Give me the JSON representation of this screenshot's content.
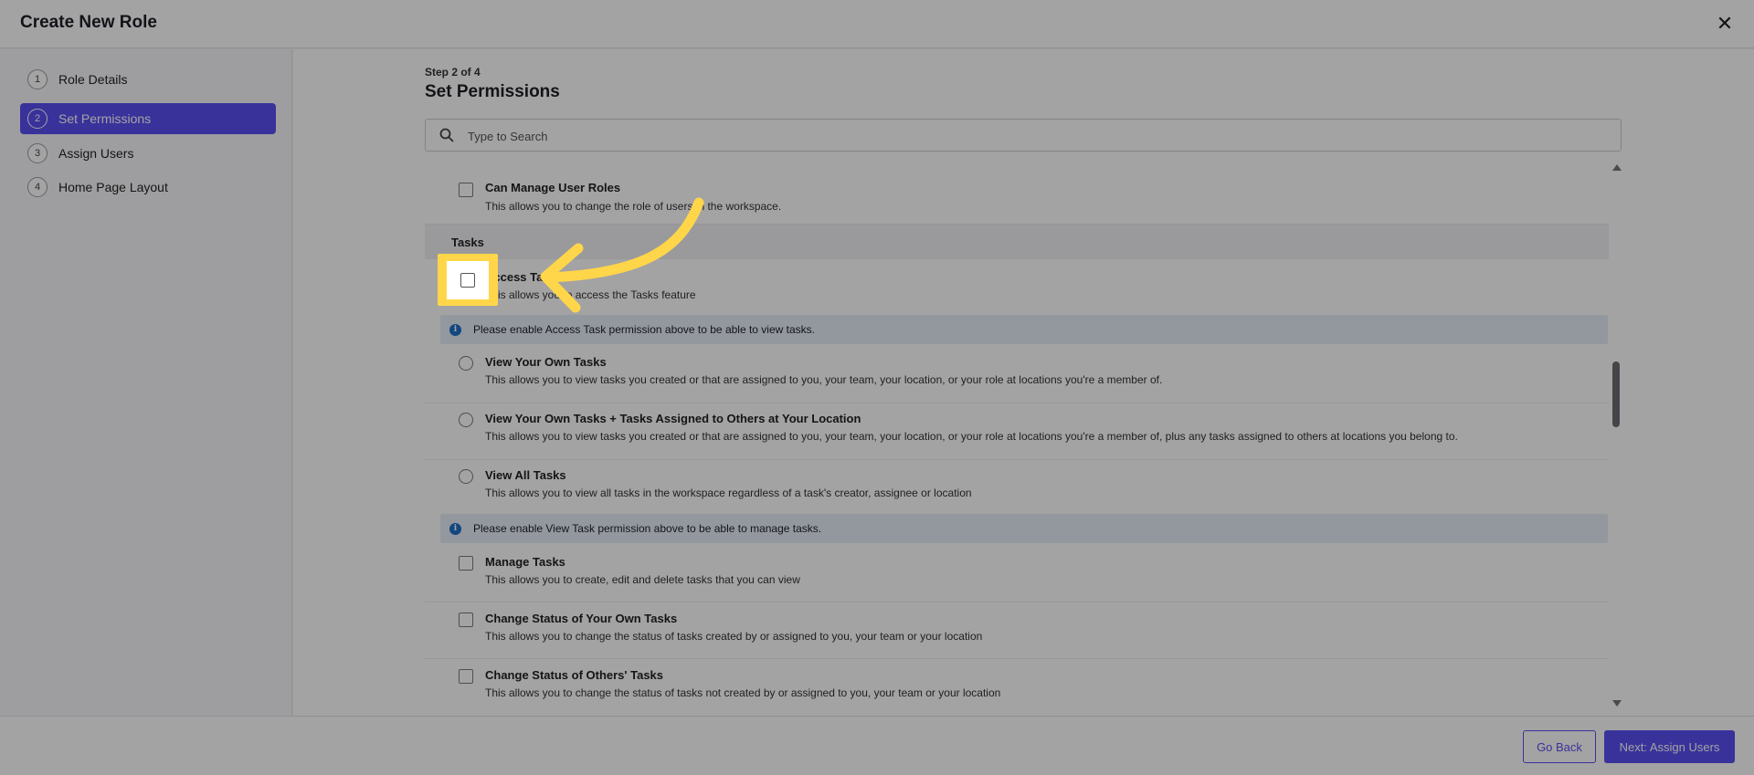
{
  "window": {
    "title": "Create New Role",
    "close_icon": "close-icon"
  },
  "sidebar": {
    "steps": [
      {
        "num": "1",
        "label": "Role Details"
      },
      {
        "num": "2",
        "label": "Set Permissions"
      },
      {
        "num": "3",
        "label": "Assign Users"
      },
      {
        "num": "4",
        "label": "Home Page Layout"
      }
    ],
    "active_step": 2
  },
  "main": {
    "step_label": "Step 2 of 4",
    "title": "Set Permissions",
    "search": {
      "placeholder": "Type to Search",
      "value": ""
    }
  },
  "permissions": {
    "manage_user_roles": {
      "name": "Can Manage User Roles",
      "desc": "This allows you to change the role of users in the workspace."
    },
    "tasks_section": "Tasks",
    "access_tasks": {
      "name": "Access Tasks",
      "desc": "This allows you to access the Tasks feature"
    },
    "info_access": "Please enable Access Task permission above to be able to view tasks.",
    "view_own": {
      "name": "View Your Own Tasks",
      "desc": "This allows you to view tasks you created or that are assigned to you, your team, your location, or your role at locations you're a member of."
    },
    "view_own_location": {
      "name": "View Your Own Tasks + Tasks Assigned to Others at Your Location",
      "desc": "This allows you to view tasks you created or that are assigned to you, your team, your location, or your role at locations you're a member of, plus any tasks assigned to others at locations you belong to."
    },
    "view_all": {
      "name": "View All Tasks",
      "desc": "This allows you to view all tasks in the workspace regardless of a task's creator, assignee or location"
    },
    "info_view": "Please enable View Task permission above to be able to manage tasks.",
    "manage": {
      "name": "Manage Tasks",
      "desc": "This allows you to create, edit and delete tasks that you can view"
    },
    "status_own": {
      "name": "Change Status of Your Own Tasks",
      "desc": "This allows you to change the status of tasks created by or assigned to you, your team or your location"
    },
    "status_others": {
      "name": "Change Status of Others' Tasks",
      "desc": "This allows you to change the status of tasks not created by or assigned to you, your team or your location"
    }
  },
  "footer": {
    "back_label": "Go Back",
    "next_label": "Next: Assign Users"
  },
  "colors": {
    "accent": "#5a4ff2",
    "highlight": "#ffd64a",
    "info": "#1e6fc8"
  }
}
